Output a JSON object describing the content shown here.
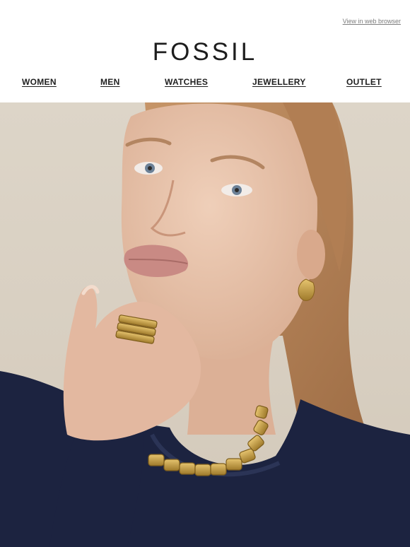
{
  "header": {
    "view_in_browser": "View in web browser",
    "logo_text": "FOSSIL"
  },
  "nav": {
    "items": [
      {
        "label": "WOMEN"
      },
      {
        "label": "MEN"
      },
      {
        "label": "WATCHES"
      },
      {
        "label": "JEWELLERY"
      },
      {
        "label": "OUTLET"
      }
    ]
  },
  "hero": {
    "subject": "woman-wearing-gold-chain-necklace-ring-and-earring",
    "colors": {
      "background": "#d8cfc1",
      "sweater": "#1c2340",
      "hair": "#b7845a",
      "skin": "#e8c4ad",
      "gold": "#c9a24a"
    }
  }
}
